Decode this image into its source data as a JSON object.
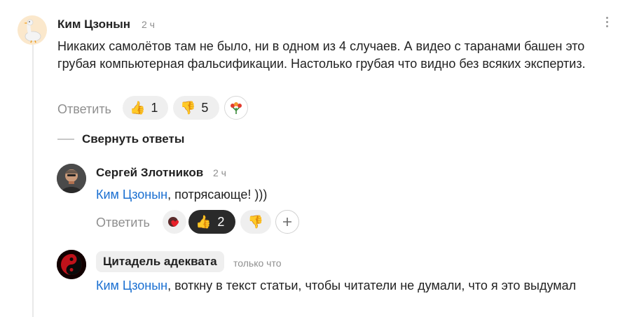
{
  "comment1": {
    "author": "Ким Цзонын",
    "time": "2 ч",
    "text": "Никаких самолётов там не было, ни в одном из 4 случаев. А видео с таранами башен это грубая компьютерная фальсификации. Настолько грубая что видно без всяких экспертиз.",
    "reply_label": "Ответить",
    "likes": "1",
    "dislikes": "5",
    "avatar_icon": "goose-avatar",
    "menu_icon": "kebab-menu-icon"
  },
  "collapse": {
    "label": "Свернуть ответы"
  },
  "comment2": {
    "author": "Сергей Злотников",
    "time": "2 ч",
    "mention": "Ким Цзонын",
    "text": ", потрясающе! )))",
    "reply_label": "Ответить",
    "likes": "2",
    "avatar_icon": "user-photo-avatar"
  },
  "comment3": {
    "author": "Цитадель адеквата",
    "time": "только что",
    "mention": "Ким Цзонын",
    "text": ", воткну в текст статьи, чтобы читатели не думали, что я это выдумал",
    "avatar_icon": "yin-yang-avatar"
  },
  "colors": {
    "mention": "#1a6fd1",
    "pill": "#efefef",
    "pill_active": "#2a2a2a"
  }
}
